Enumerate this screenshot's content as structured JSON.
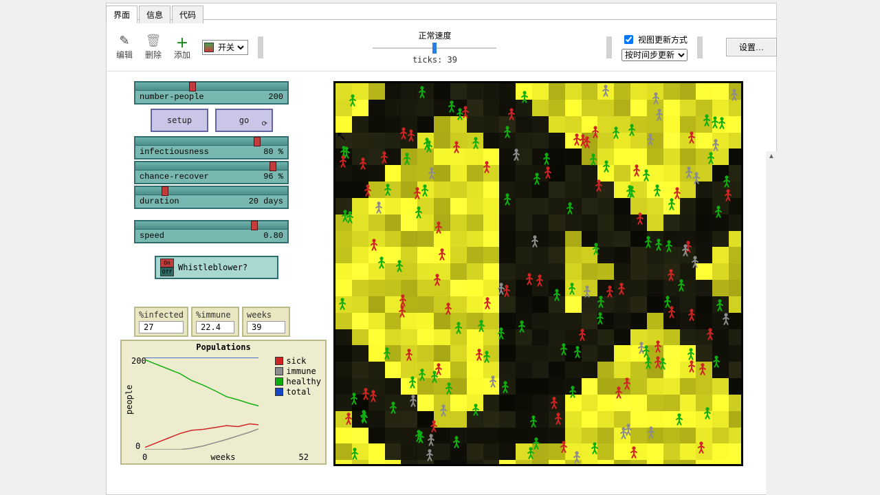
{
  "tabs": {
    "interface": "界面",
    "info": "信息",
    "code": "代码"
  },
  "toolbar": {
    "edit": "编辑",
    "delete": "删除",
    "add": "添加",
    "switch_label": "开关",
    "speed_label": "正常速度",
    "ticks_label": "ticks:",
    "ticks_value": "39",
    "view_update_label": "视图更新方式",
    "view_update_mode": "按时间步更新",
    "settings": "设置…"
  },
  "sliders": {
    "number_people": {
      "label": "number-people",
      "value": "200",
      "pos": 37
    },
    "infectiousness": {
      "label": "infectiousness",
      "value": "80 %",
      "pos": 82
    },
    "chance_recover": {
      "label": "chance-recover",
      "value": "96 %",
      "pos": 93
    },
    "duration": {
      "label": "duration",
      "value": "20 days",
      "pos": 18
    },
    "speed": {
      "label": "speed",
      "value": "0.80",
      "pos": 80
    }
  },
  "buttons": {
    "setup": "setup",
    "go": "go"
  },
  "switch": {
    "on": "On",
    "off": "Off",
    "label": "Whistleblower?"
  },
  "monitors": {
    "infected": {
      "label": "%infected",
      "value": "27"
    },
    "immune": {
      "label": "%immune",
      "value": "22.4"
    },
    "weeks": {
      "label": "weeks",
      "value": "39"
    }
  },
  "chart_data": {
    "type": "line",
    "title": "Populations",
    "xlabel": "weeks",
    "ylabel": "people",
    "xlim": [
      0,
      52
    ],
    "ylim": [
      0,
      200
    ],
    "series": [
      {
        "name": "sick",
        "color": "#d02424",
        "x": [
          0,
          4,
          8,
          12,
          16,
          20,
          24,
          28,
          32,
          36,
          39
        ],
        "y": [
          5,
          15,
          25,
          35,
          42,
          44,
          48,
          52,
          50,
          56,
          54
        ]
      },
      {
        "name": "immune",
        "color": "#8c8c8c",
        "x": [
          0,
          12,
          16,
          20,
          24,
          28,
          32,
          36,
          39
        ],
        "y": [
          0,
          0,
          3,
          8,
          15,
          22,
          30,
          38,
          45
        ]
      },
      {
        "name": "healthy",
        "color": "#0fae0f",
        "x": [
          0,
          4,
          8,
          12,
          16,
          20,
          24,
          28,
          32,
          36,
          39
        ],
        "y": [
          195,
          185,
          175,
          165,
          150,
          140,
          128,
          115,
          108,
          100,
          95
        ]
      },
      {
        "name": "total",
        "color": "#1646c8",
        "x": [
          0,
          39
        ],
        "y": [
          200,
          200
        ]
      }
    ]
  },
  "world": {
    "colors": {
      "sick": "#d02424",
      "immune": "#8c8c8c",
      "healthy": "#0fae0f"
    },
    "grid": 25,
    "people_approx": 200
  }
}
